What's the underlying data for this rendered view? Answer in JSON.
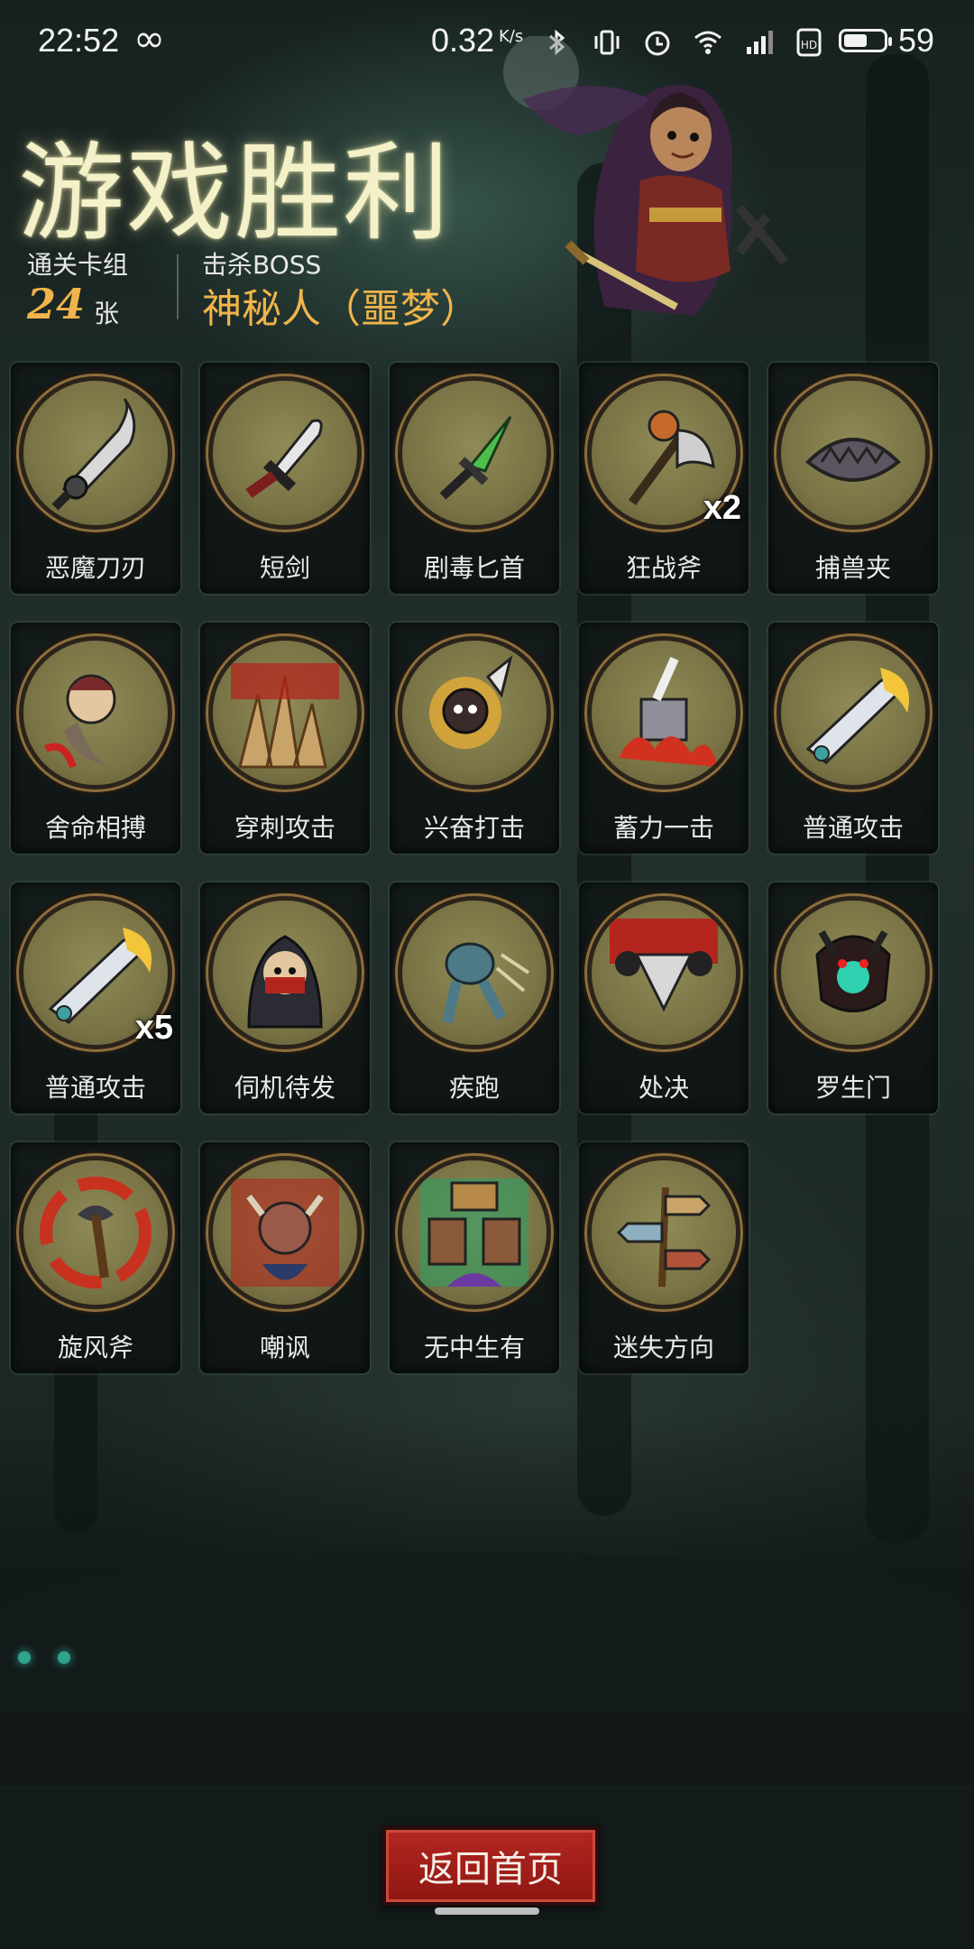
{
  "status_bar": {
    "time": "22:52",
    "loop_icon": "∞",
    "network_speed": "0.32",
    "network_speed_unit": "K/s",
    "icons": [
      "bluetooth-icon",
      "vibrate-icon",
      "alarm-icon",
      "wifi-icon",
      "signal-4g-icon",
      "hd-icon"
    ],
    "battery_level": 59,
    "battery_text": "59"
  },
  "header": {
    "title": "游戏胜利",
    "deck_label": "通关卡组",
    "deck_count": "24",
    "deck_unit": "张",
    "boss_label": "击杀BOSS",
    "boss_name": "神秘人（噩梦）"
  },
  "cards": [
    {
      "label": "恶魔刀刃",
      "icon": "demon-blade-icon",
      "badge": ""
    },
    {
      "label": "短剑",
      "icon": "short-sword-icon",
      "badge": ""
    },
    {
      "label": "剧毒匕首",
      "icon": "poison-dagger-icon",
      "badge": ""
    },
    {
      "label": "狂战斧",
      "icon": "berserker-axe-icon",
      "badge": "x2"
    },
    {
      "label": "捕兽夹",
      "icon": "bear-trap-icon",
      "badge": ""
    },
    {
      "label": "舍命相搏",
      "icon": "desperate-fight-icon",
      "badge": ""
    },
    {
      "label": "穿刺攻击",
      "icon": "piercing-attack-icon",
      "badge": ""
    },
    {
      "label": "兴奋打击",
      "icon": "excited-strike-icon",
      "badge": ""
    },
    {
      "label": "蓄力一击",
      "icon": "charged-strike-icon",
      "badge": ""
    },
    {
      "label": "普通攻击",
      "icon": "normal-attack-icon",
      "badge": ""
    },
    {
      "label": "普通攻击",
      "icon": "normal-attack-icon",
      "badge": "x5"
    },
    {
      "label": "伺机待发",
      "icon": "ambush-icon",
      "badge": ""
    },
    {
      "label": "疾跑",
      "icon": "sprint-icon",
      "badge": ""
    },
    {
      "label": "处决",
      "icon": "execute-icon",
      "badge": ""
    },
    {
      "label": "罗生门",
      "icon": "rashomon-icon",
      "badge": ""
    },
    {
      "label": "旋风斧",
      "icon": "whirlwind-axe-icon",
      "badge": ""
    },
    {
      "label": "嘲讽",
      "icon": "taunt-icon",
      "badge": ""
    },
    {
      "label": "无中生有",
      "icon": "something-from-nothing-icon",
      "badge": ""
    },
    {
      "label": "迷失方向",
      "icon": "lost-direction-icon",
      "badge": ""
    }
  ],
  "footer": {
    "home_button_label": "返回首页"
  },
  "colors": {
    "title": "#f4f1c8",
    "accent_gold": "#f0b44a",
    "button_red": "#a81f1b",
    "card_circle": "#8a8450"
  }
}
